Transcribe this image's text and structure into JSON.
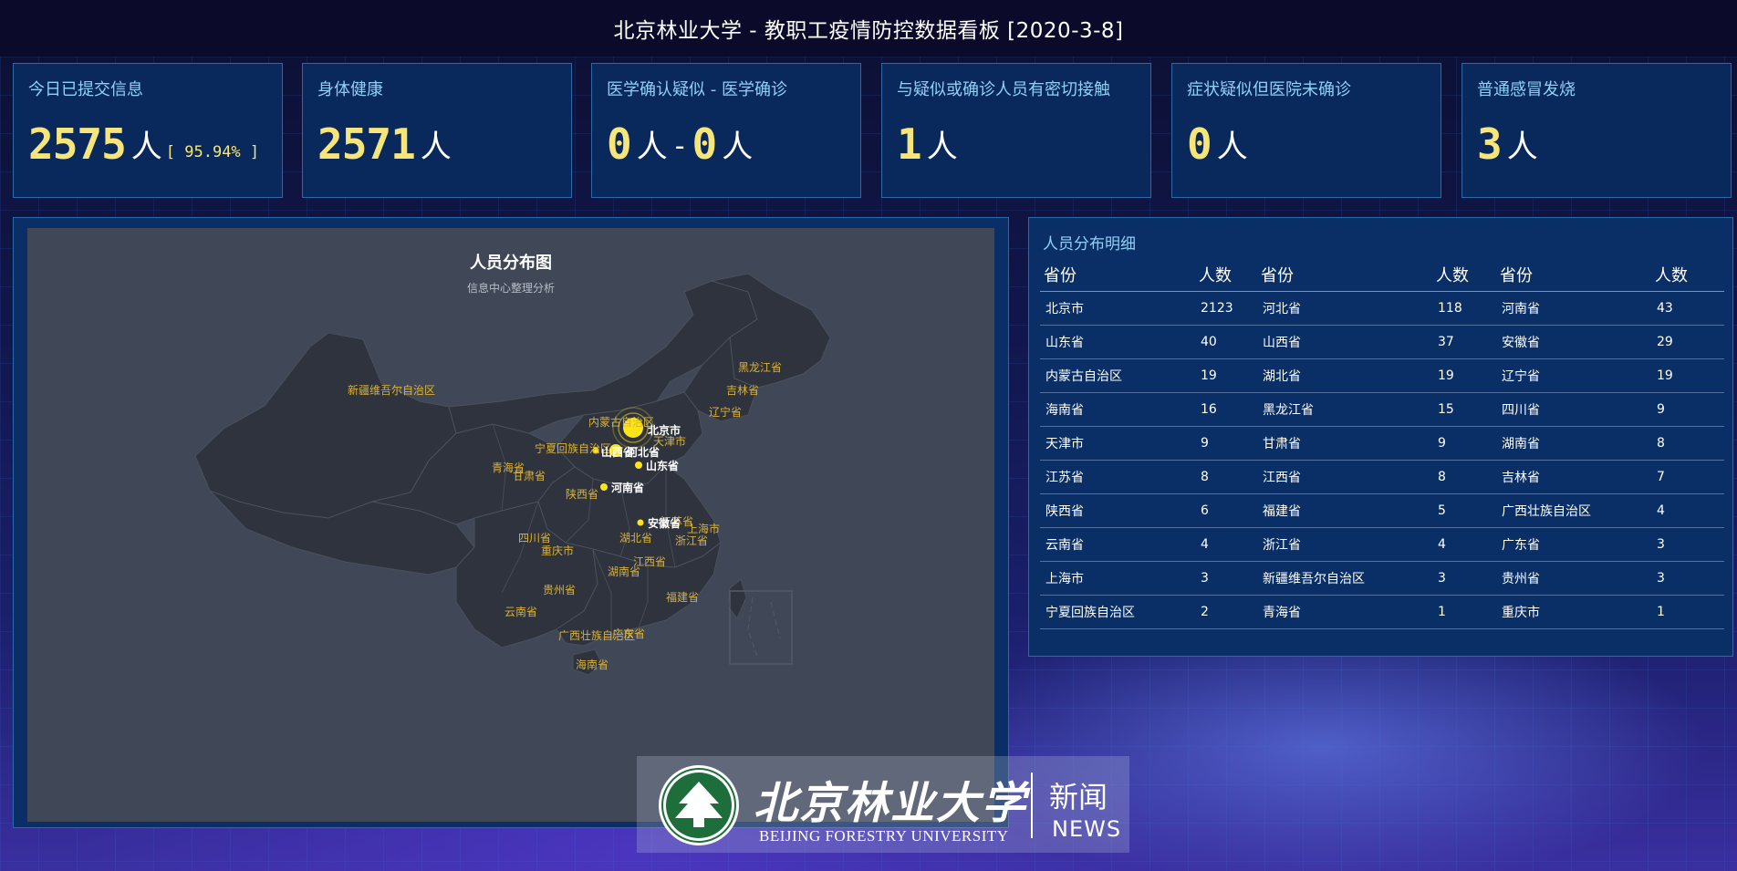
{
  "header": {
    "title": "北京林业大学 - 教职工疫情防控数据看板 [2020-3-8]"
  },
  "stats": [
    {
      "label": "今日已提交信息",
      "value": "2575",
      "unit": "人",
      "pct": "[ 95.94% ]"
    },
    {
      "label": "身体健康",
      "value": "2571",
      "unit": "人"
    },
    {
      "label": "医学确认疑似 - 医学确诊",
      "value_a": "0",
      "unit_a": "人",
      "sep": "-",
      "value_b": "0",
      "unit_b": "人"
    },
    {
      "label": "与疑似或确诊人员有密切接触",
      "value": "1",
      "unit": "人"
    },
    {
      "label": "症状疑似但医院未确诊",
      "value": "0",
      "unit": "人"
    },
    {
      "label": "普通感冒发烧",
      "value": "3",
      "unit": "人"
    }
  ],
  "map": {
    "title": "人员分布图",
    "subtitle": "信息中心整理分析",
    "colors": {
      "region_fill": "#2e333d",
      "region_stroke": "#4a505c",
      "label": "#d9b23a",
      "bubble": "#ffe41a"
    },
    "labels": {
      "xinjiang": "新疆维吾尔自治区",
      "heilongjiang": "黑龙江省",
      "jilin": "吉林省",
      "liaoning": "辽宁省",
      "neimenggu": "内蒙古自治区",
      "beijing": "北京市",
      "tianjin": "天津市",
      "ningxia": "宁夏回族自治区",
      "shanxi": "山西省",
      "hebei": "河北省",
      "qinghai": "青海省",
      "gansu": "甘肃省",
      "shandong": "山东省",
      "henan": "河南省",
      "shaanxi": "陕西省",
      "jiangsu": "江苏省",
      "anhui": "安徽省",
      "shanghai": "上海市",
      "zhejiang": "浙江省",
      "sichuan": "四川省",
      "hubei": "湖北省",
      "chongqing": "重庆市",
      "jiangxi": "江西省",
      "hunan": "湖南省",
      "guizhou": "贵州省",
      "fujian": "福建省",
      "yunnan": "云南省",
      "guangxi": "广西壮族自治区",
      "guangdong": "广东省",
      "hainan": "海南省"
    }
  },
  "table": {
    "title": "人员分布明细",
    "headers": [
      "省份",
      "人数",
      "省份",
      "人数",
      "省份",
      "人数"
    ],
    "rows": [
      [
        "北京市",
        "2123",
        "河北省",
        "118",
        "河南省",
        "43"
      ],
      [
        "山东省",
        "40",
        "山西省",
        "37",
        "安徽省",
        "29"
      ],
      [
        "内蒙古自治区",
        "19",
        "湖北省",
        "19",
        "辽宁省",
        "19"
      ],
      [
        "海南省",
        "16",
        "黑龙江省",
        "15",
        "四川省",
        "9"
      ],
      [
        "天津市",
        "9",
        "甘肃省",
        "9",
        "湖南省",
        "8"
      ],
      [
        "江苏省",
        "8",
        "江西省",
        "8",
        "吉林省",
        "7"
      ],
      [
        "陕西省",
        "6",
        "福建省",
        "5",
        "广西壮族自治区",
        "4"
      ],
      [
        "云南省",
        "4",
        "浙江省",
        "4",
        "广东省",
        "3"
      ],
      [
        "上海市",
        "3",
        "新疆维吾尔自治区",
        "3",
        "贵州省",
        "3"
      ],
      [
        "宁夏回族自治区",
        "2",
        "青海省",
        "1",
        "重庆市",
        "1"
      ]
    ]
  },
  "logo": {
    "name_cn": "北京林业大学",
    "name_en": "BEIJING FORESTRY UNIVERSITY",
    "news_cn": "新闻",
    "news_en": "NEWS"
  }
}
